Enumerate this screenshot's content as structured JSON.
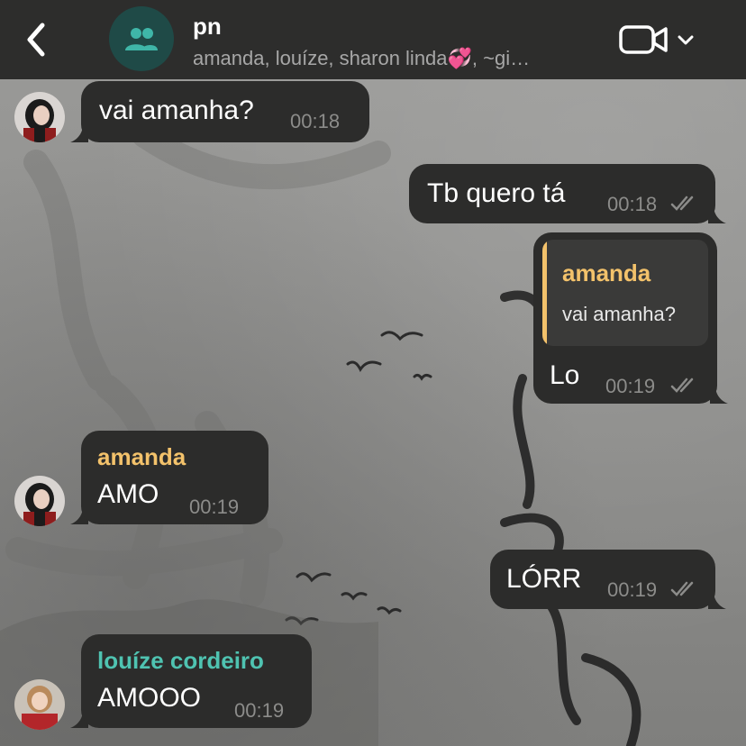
{
  "header": {
    "back_icon": "chevron-left-icon",
    "group_icon": "group-people-icon",
    "title": "pn",
    "members": "amanda, louíze, sharon linda💞, ~gi…",
    "video_icon": "video-camera-icon",
    "dropdown_icon": "chevron-down-icon"
  },
  "colors": {
    "header_bg": "#2d2d2c",
    "bubble_bg": "#2c2c2b",
    "amanda": "#f3c26b",
    "louize": "#4fc3b1",
    "time": "#8c8c8a"
  },
  "messages": [
    {
      "id": "m1",
      "direction": "in",
      "sender": "",
      "text": "vai amanha?",
      "time": "00:18"
    },
    {
      "id": "m2",
      "direction": "out",
      "text": "Tb quero tá",
      "time": "00:18",
      "status_icon": "double-check-icon"
    },
    {
      "id": "m3",
      "direction": "out",
      "reply_to": {
        "sender": "amanda",
        "text": "vai amanha?"
      },
      "text": "Lo",
      "time": "00:19",
      "status_icon": "double-check-icon"
    },
    {
      "id": "m4",
      "direction": "in",
      "sender": "amanda",
      "text": "AMO",
      "time": "00:19"
    },
    {
      "id": "m5",
      "direction": "out",
      "text": "LÓRR",
      "time": "00:19",
      "status_icon": "double-check-icon"
    },
    {
      "id": "m6",
      "direction": "in",
      "sender": "louíze cordeiro",
      "text": "AMOOO",
      "time": "00:19"
    }
  ]
}
